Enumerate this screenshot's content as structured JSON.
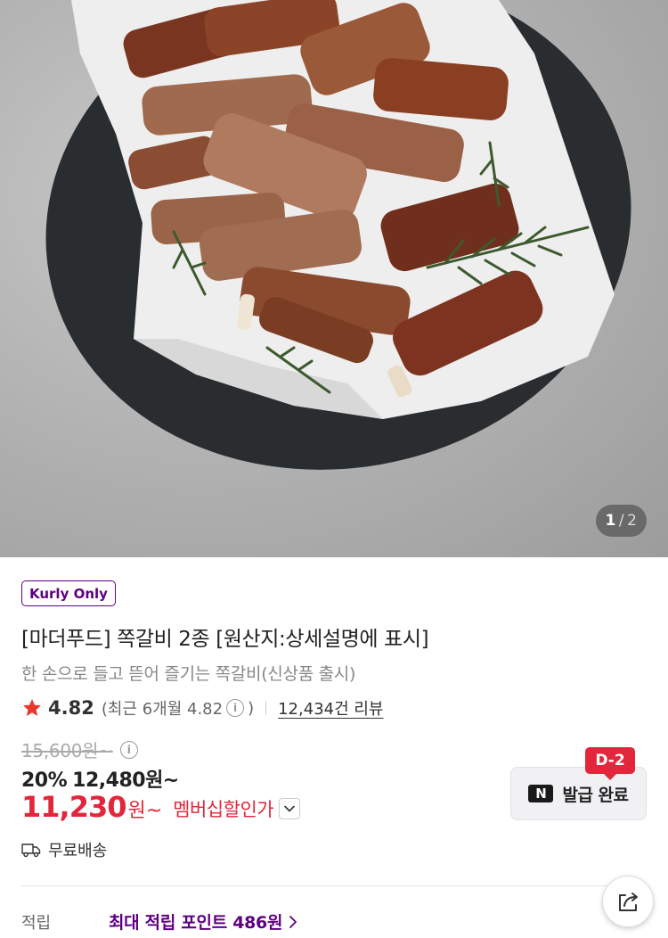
{
  "hero": {
    "counter_current": "1",
    "counter_separator": "/",
    "counter_total": "2"
  },
  "product": {
    "badge": "Kurly Only",
    "title": "[마더푸드] 쪽갈비 2종 [원산지:상세설명에 표시]",
    "subtitle": "한 손으로 들고 뜯어 즐기는 쪽갈비(신상품 출시)",
    "rating": "4.82",
    "recent_prefix": "(최근 6개월 4.82",
    "recent_suffix": ")",
    "review_count": "12,434건 리뷰",
    "original_price": "15,600원~",
    "discount_rate": "20%",
    "discount_price": "12,480원~",
    "member_price": "11,230",
    "member_unit": "원~",
    "member_label": "멤버십할인가",
    "shipping": "무료배송",
    "points_label": "적립",
    "points_value": "최대 적립 포인트 486원"
  },
  "coupon": {
    "dday": "D-2",
    "logo": "N",
    "label": "발급 완료"
  },
  "colors": {
    "kurly_purple": "#5f0080",
    "member_red": "#e2263b",
    "star_red": "#e8372e"
  },
  "icons": {
    "star": "star-icon",
    "info": "info-icon",
    "chevron": "chevron-down-icon",
    "truck": "truck-icon",
    "arrow": "chevron-right-icon",
    "share": "share-icon"
  }
}
